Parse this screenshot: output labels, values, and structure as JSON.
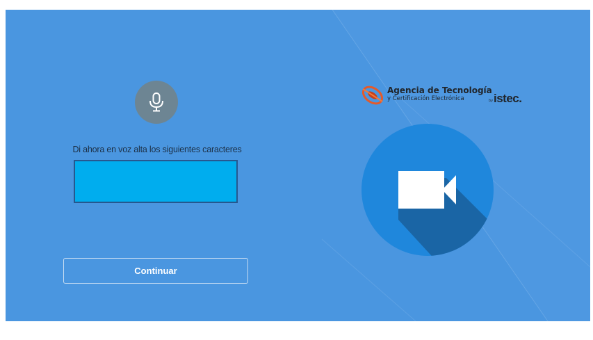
{
  "voice_check": {
    "prompt": "Di ahora en voz alta los siguientes caracteres",
    "code_value": "",
    "continue_label": "Continuar"
  },
  "brand": {
    "title": "Agencia de Tecnología",
    "subtitle": "y Certificación Electrónica",
    "by": "by",
    "partner": "istec."
  },
  "icons": {
    "microphone": "microphone-icon",
    "camera": "video-camera-icon",
    "logo": "agency-logo-icon"
  },
  "colors": {
    "background": "#4a96e0",
    "code_box": "#00adee",
    "camera_circle": "#1f87dc",
    "mic_circle": "#6d8593"
  }
}
